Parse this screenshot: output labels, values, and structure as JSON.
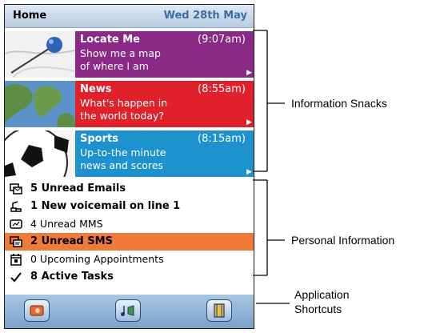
{
  "header": {
    "home": "Home",
    "date": "Wed 28th May"
  },
  "snacks": [
    {
      "title": "Locate Me",
      "time": "(9:07am)",
      "line1": "Show me a map",
      "line2": "of where I am",
      "color": "#8a2a86"
    },
    {
      "title": "News",
      "time": "(8:55am)",
      "line1": "What's happen in",
      "line2": "the world today?",
      "color": "#e0202a"
    },
    {
      "title": "Sports",
      "time": "(8:15am)",
      "line1": "Up-to-the minute",
      "line2": "news and scores",
      "color": "#1e92cf"
    }
  ],
  "personal": [
    {
      "text": "5 Unread Emails",
      "icon": "email-icon"
    },
    {
      "text": "1 New voicemail on line 1",
      "icon": "voicemail-icon"
    },
    {
      "text": "4 Unread MMS",
      "icon": "mms-icon"
    },
    {
      "text": "2 Unread SMS",
      "icon": "sms-icon"
    },
    {
      "text": "0 Upcoming Appointments",
      "icon": "calendar-icon"
    },
    {
      "text": "8 Active Tasks",
      "icon": "checkmark-icon"
    }
  ],
  "shortcuts": [
    "camera-icon",
    "music-icon",
    "video-icon"
  ],
  "callouts": {
    "snacks": "Information Snacks",
    "personal": "Personal Information",
    "shortcuts_1": "Application",
    "shortcuts_2": "Shortcuts"
  }
}
